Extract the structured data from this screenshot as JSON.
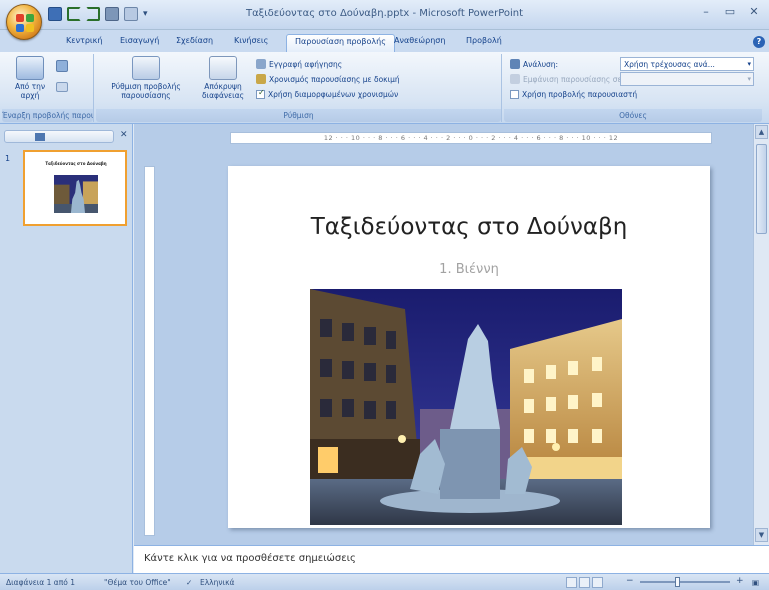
{
  "window": {
    "title": "Ταξιδεύοντας στο Δούναβη.pptx - Microsoft PowerPoint"
  },
  "tabs": [
    "Κεντρική",
    "Εισαγωγή",
    "Σχεδίαση",
    "Κινήσεις",
    "Παρουσίαση προβολής",
    "Αναθεώρηση",
    "Προβολή"
  ],
  "ribbon": {
    "groups": {
      "start": "Έναρξη προβολής παρουσίασης",
      "setup": "Ρύθμιση",
      "monitors": "Οθόνες"
    },
    "from_beginning": "Από την αρχή",
    "setup_show": "Ρύθμιση προβολής παρουσίασης",
    "hide_slide": "Απόκρυψη διαφάνειας",
    "record_narration": "Εγγραφή αφήγησης",
    "rehearse_timings": "Χρονισμός παρουσίασης με δοκιμή",
    "use_timings": "Χρήση διαμορφωμένων χρονισμών",
    "resolution_label": "Ανάλυση:",
    "resolution_value": "Χρήση τρέχουσας ανά...",
    "show_on_label": "Εμφάνιση παρουσίασης σε:",
    "presenter_view": "Χρήση προβολής παρουσιαστή"
  },
  "slide": {
    "title": "Ταξιδεύοντας στο Δούναβη",
    "subtitle": "1. Βιέννη",
    "number": "1"
  },
  "ruler": {
    "text": "12 · · · 10 · · · 8 · · · 6 · · · 4 · · · 2 · · · 0 · · · 2 · · · 4 · · · 6 · · · 8 · · · 10 · · · 12"
  },
  "notes": {
    "placeholder": "Κάντε κλικ για να προσθέσετε σημειώσεις"
  },
  "status": {
    "slide_of": "Διαφάνεια 1 από 1",
    "theme": "\"Θέμα του Office\"",
    "language": "Ελληνικά"
  },
  "colors": {
    "ribbon_text": "#15428b",
    "thumb_border": "#f0a030",
    "app_background": "#b6cce8"
  }
}
